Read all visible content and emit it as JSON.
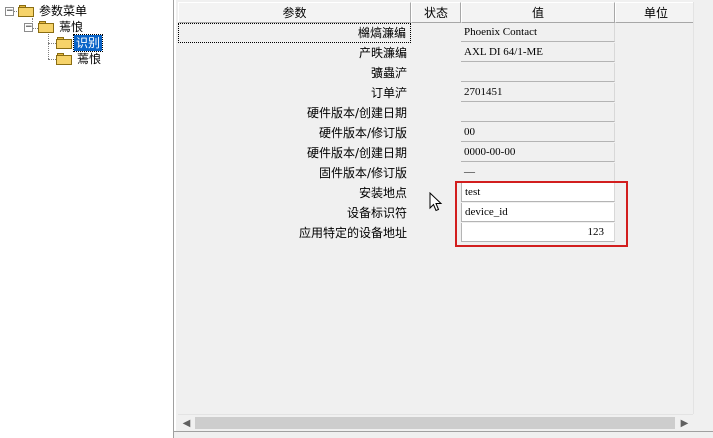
{
  "tree": {
    "root_label": "参数菜单",
    "child_label": "蔫悢",
    "selected_label": "识别",
    "sibling_label": "蔫悢"
  },
  "grid": {
    "headers": {
      "param": "参数",
      "status": "状态",
      "value": "值",
      "unit": "单位"
    },
    "rows": [
      {
        "param": "檰熇濂编",
        "value": "Phoenix Contact",
        "editable": false
      },
      {
        "param": "产昳濂编",
        "value": "AXL DI 64/1-ME",
        "editable": false
      },
      {
        "param": "彍蟲浐",
        "value": "",
        "editable": false
      },
      {
        "param": "订单浐",
        "value": "2701451",
        "editable": false
      },
      {
        "param": "硬件版本/创建日期",
        "value": "",
        "editable": false
      },
      {
        "param": "硬件版本/修订版",
        "value": "00",
        "editable": false
      },
      {
        "param": "硬件版本/创建日期",
        "value": "0000-00-00",
        "editable": false
      },
      {
        "param": "固件版本/修订版",
        "value": "—",
        "editable": false
      },
      {
        "param": "安装地点",
        "value": "test",
        "editable": true
      },
      {
        "param": "设备标识符",
        "value": "device_id",
        "editable": true
      },
      {
        "param": "应用特定的设备地址",
        "value": "123",
        "editable": true
      }
    ]
  },
  "icons": {
    "expander": "minus-box-icon",
    "folder": "folder-icon",
    "scroll_left": "arrow-left-icon",
    "scroll_right": "arrow-right-icon",
    "cursor": "mouse-pointer-icon"
  },
  "colors": {
    "highlight_border": "#d21e1e",
    "selection": "#0a64c8"
  }
}
